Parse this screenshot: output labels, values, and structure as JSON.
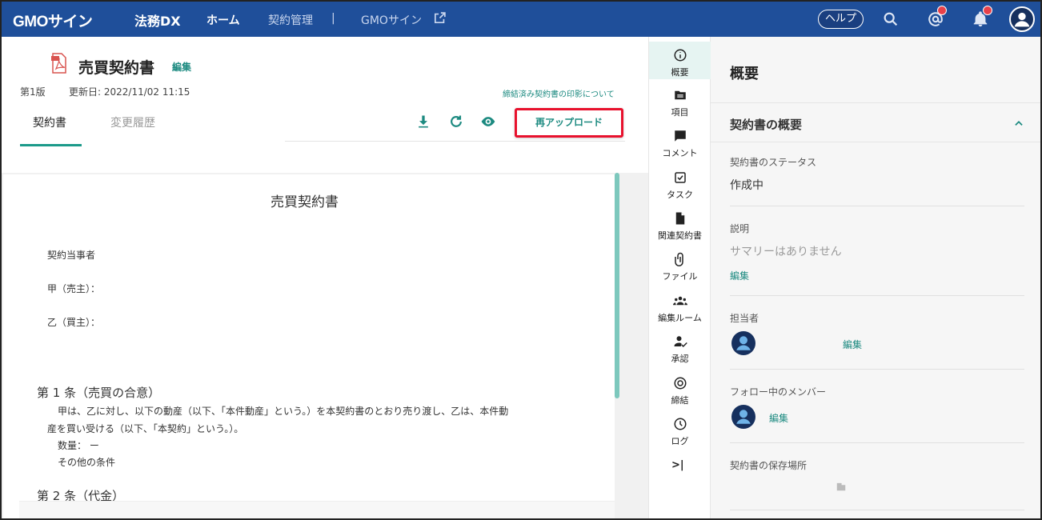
{
  "topbar": {
    "brand": "GMOサイン",
    "brand_sub": "法務DX",
    "nav_home": "ホーム",
    "nav_contracts": "契約管理",
    "nav_sep": "|",
    "nav_gmo": "GMOサイン",
    "help": "ヘルプ",
    "icons": [
      "search-icon",
      "mention-icon",
      "bell-icon",
      "user-avatar"
    ]
  },
  "doc": {
    "title": "売買契約書",
    "edit": "編集",
    "version": "第1版",
    "updated": "更新日: 2022/11/02 11:15",
    "seal_link": "締結済み契約書の印影について",
    "tabs": [
      "契約書",
      "変更履歴"
    ],
    "reupload": "再アップロード"
  },
  "paper": {
    "title": "売買契約書",
    "parties": "契約当事者",
    "party_a": "甲（売主）：",
    "party_b": "乙（買主）：",
    "article1": "第 1 条（売買の合意）",
    "article1_line1": "甲は、乙に対し、以下の動産（以下、「本件動産」という。）を本契約書のとおり売り渡し、乙は、本件動",
    "article1_line2": "産を買い受ける（以下、「本契約」という。）。",
    "quantity": "数量：  ー",
    "other": "その他の条件",
    "article2": "第 2 条（代金）"
  },
  "rail": {
    "items": [
      "概要",
      "項目",
      "コメント",
      "タスク",
      "関連契約書",
      "ファイル",
      "編集ルーム",
      "承認",
      "締結",
      "ログ"
    ],
    "collapse": ">|"
  },
  "overview": {
    "title": "概要",
    "section": "契約書の概要",
    "status_label": "契約書のステータス",
    "status_value": "作成中",
    "desc_label": "説明",
    "desc_value": "サマリーはありません",
    "desc_edit": "編集",
    "owner_label": "担当者",
    "owner_edit": "編集",
    "followers_label": "フォロー中のメンバー",
    "followers_edit": "編集",
    "storage_label": "契約書の保存場所"
  },
  "colors": {
    "nav": "#1f4f9a",
    "accent": "#1c8a80",
    "highlight": "#e8112d"
  }
}
